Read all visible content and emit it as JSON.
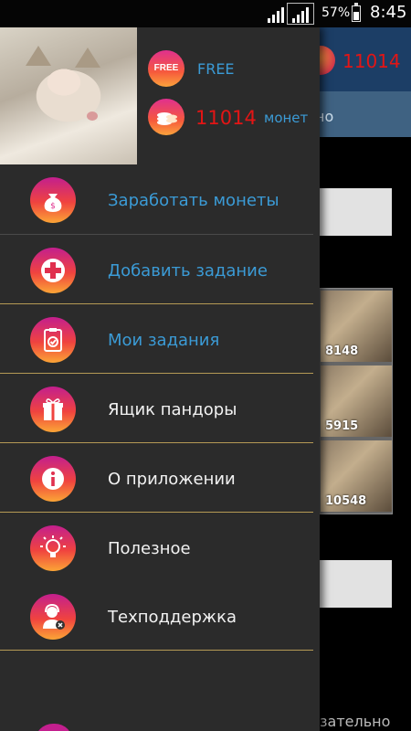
{
  "status_bar": {
    "battery_percent": "57%",
    "time": "8:45"
  },
  "background_app": {
    "coins": "11014",
    "tab_text": "но",
    "grid": [
      {
        "count": "8148"
      },
      {
        "count": "5915"
      },
      {
        "count": "10548"
      }
    ],
    "bottom_text": "зательно"
  },
  "drawer": {
    "profile": {
      "free_label": "FREE",
      "free_badge": "FREE",
      "coins_value": "11014",
      "coins_unit": "монет"
    },
    "menu": [
      {
        "label": "Заработать монеты",
        "icon": "money-bag-icon",
        "color": "#3b9bd6"
      },
      {
        "label": "Добавить задание",
        "icon": "plus-icon",
        "color": "#3b9bd6"
      },
      {
        "label": "Мои задания",
        "icon": "clipboard-check-icon",
        "color": "#3b9bd6"
      },
      {
        "label": "Ящик пандоры",
        "icon": "gift-icon",
        "color": "#f2f2f2"
      },
      {
        "label": "О приложении",
        "icon": "info-icon",
        "color": "#f2f2f2"
      },
      {
        "label": "Полезное",
        "icon": "lightbulb-icon",
        "color": "#f2f2f2"
      },
      {
        "label": "Техподдержка",
        "icon": "support-agent-icon",
        "color": "#f2f2f2"
      }
    ]
  },
  "colors": {
    "accent_blue": "#3b9bd6",
    "coins_red": "#e31515",
    "drawer_bg": "#2b2b2b",
    "divider_gold": "#b59a55"
  }
}
